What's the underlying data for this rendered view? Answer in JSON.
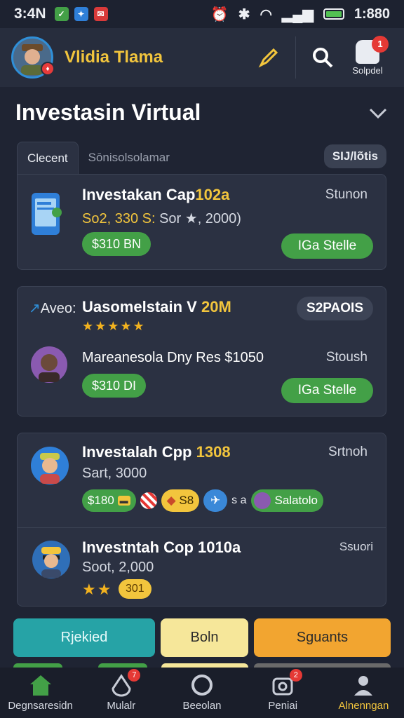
{
  "status_bar": {
    "time": "3:4N",
    "clock": "1:880"
  },
  "header": {
    "user_name": "Vlidia Tlama",
    "notification_label": "Solpdel",
    "notification_count": "1"
  },
  "section": {
    "title": "Investasin Virtual"
  },
  "tabs": [
    {
      "label": "Clecent",
      "active": true
    },
    {
      "label": "Sōnisolsolamar",
      "active": false
    }
  ],
  "tab_badge": "SIJ/lõtis",
  "cards": [
    {
      "title_main": "Investakan Cap",
      "title_accent": "102a",
      "meta_accent": "So2, 330 S:",
      "meta_rest": " Sor ★, 2000)",
      "status": "Stunon",
      "amount": "$310 BN",
      "action": "IGa Stelle"
    },
    {
      "brand": "Aveo:",
      "title_main": "Uasomelstain V",
      "title_accent": "20M",
      "badge": "S2PAOIS",
      "rating": "★★★★★",
      "meta": "Mareanesola Dny Res $1050",
      "status": "Stoush",
      "amount": "$310 DI",
      "action": "IGa Stelle"
    },
    {
      "title_main": "Investalah Cpp",
      "title_accent": "1308",
      "meta": "Sart, 3000",
      "status": "Srtnoh",
      "token_green": "$180",
      "token_yellow": "S8",
      "token_text": "s a",
      "token_end": "Salatolo"
    },
    {
      "title_main": "Investntah Cop 1010a",
      "meta": "Soot, 2,000",
      "status": "Ssuori",
      "rating": "★★",
      "rating_value": "301"
    }
  ],
  "actions": {
    "primary": "Rjekied",
    "secondary": "Boln",
    "tertiary": "Sguants"
  },
  "bottom_nav": [
    {
      "label": "Degnsaresidn",
      "active": false,
      "badge": ""
    },
    {
      "label": "Mulalr",
      "active": false,
      "badge": "7"
    },
    {
      "label": "Beeolan",
      "active": false,
      "badge": ""
    },
    {
      "label": "Peniai",
      "active": false,
      "badge": "2"
    },
    {
      "label": "Alnenngan",
      "active": true,
      "badge": ""
    }
  ],
  "colors": {
    "accent_yellow": "#f2c53d",
    "green": "#43a047",
    "teal": "#26a3a6",
    "orange": "#f2a530",
    "bg": "#1f2433"
  }
}
